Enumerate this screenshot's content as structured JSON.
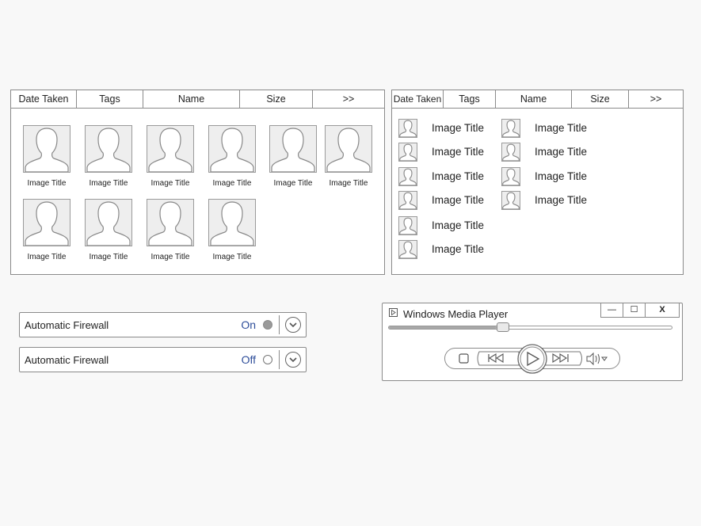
{
  "grid_view": {
    "columns": [
      "Date Taken",
      "Tags",
      "Name",
      "Size",
      ">>"
    ],
    "items": [
      "Image Title",
      "Image Title",
      "Image Title",
      "Image Title",
      "Image Title",
      "Image Title",
      "Image Title",
      "Image Title",
      "Image Title",
      "Image Title"
    ]
  },
  "list_view": {
    "columns": [
      "Date Taken",
      "Tags",
      "Name",
      "Size",
      ">>"
    ],
    "items": [
      "Image Title",
      "Image Title",
      "Image Title",
      "Image Title",
      "Image Title",
      "Image Title",
      "Image Title",
      "Image Title",
      "Image Title",
      "Image Title"
    ]
  },
  "firewall": [
    {
      "label": "Automatic Firewall",
      "state": "On"
    },
    {
      "label": "Automatic Firewall",
      "state": "Off"
    }
  ],
  "media_player": {
    "title": "Windows Media Player",
    "minimize": "—",
    "maximize": "☐",
    "close": "X",
    "progress": 0.38
  },
  "icons": {
    "thumbnail": "person-silhouette-icon",
    "chevron": "chevron-down-icon",
    "stop": "stop-icon",
    "previous": "previous-icon",
    "play": "play-icon",
    "next": "next-icon",
    "volume": "volume-icon"
  }
}
